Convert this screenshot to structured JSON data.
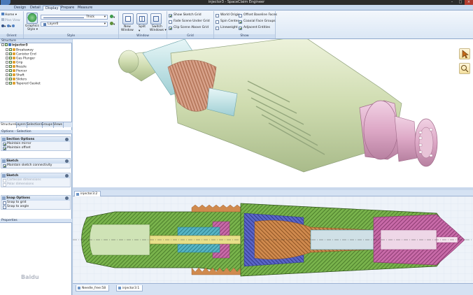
{
  "window": {
    "title": "injector3 - SpaceClaim Engineer",
    "min": "–",
    "max": "□",
    "close": "×"
  },
  "tabs": [
    "Design",
    "Detail",
    "Display",
    "Prepare",
    "Measure"
  ],
  "ribbon": {
    "orient": {
      "label": "Orient",
      "home": "Home",
      "plan_view": "Plan View"
    },
    "style": {
      "label": "Style",
      "graphics_style_top": "Graphics",
      "graphics_style_bottom": "Style",
      "line_weight": "Thick",
      "layer": "Layer0"
    },
    "window": {
      "label": "Window",
      "new_window_top": "New",
      "new_window_bottom": "Window",
      "split": "Split",
      "switch_top": "Switch",
      "switch_bottom": "Windows"
    },
    "grid": {
      "label": "Grid",
      "items": [
        {
          "label": "Show Sketch Grid",
          "checked": true
        },
        {
          "label": "Fade Scene Under Grid",
          "checked": false
        },
        {
          "label": "Clip Scene Above Grid",
          "checked": true
        }
      ]
    },
    "show": {
      "label": "Show",
      "col1": [
        {
          "label": "World Origin",
          "checked": false
        },
        {
          "label": "Spin Center",
          "checked": false
        },
        {
          "label": "Lineweight",
          "checked": false
        }
      ],
      "col2": [
        {
          "label": "Offset Baseline Faces",
          "checked": false
        },
        {
          "label": "Coaxial Face Groups",
          "checked": true
        },
        {
          "label": "Adjacent Entities",
          "checked": true
        }
      ]
    }
  },
  "structure": {
    "header": "Structure",
    "root": "injector3",
    "items": [
      "Breakaway",
      "Canister End",
      "Gas Plunger",
      "Grip",
      "Nozzle",
      "Piercer",
      "Shaft",
      "Sliders",
      "Tapered Gasket"
    ],
    "tabs": [
      "Structure",
      "Layers",
      "Selection",
      "Groups",
      "Views"
    ]
  },
  "options": {
    "header": "Options - Selection",
    "sections": [
      {
        "title": "Section Options",
        "rows": [
          {
            "label": "Maintain mirror",
            "checked": true,
            "disabled": false
          },
          {
            "label": "Maintain offset",
            "checked": true,
            "disabled": false
          }
        ]
      },
      {
        "title": "Sketch",
        "rows": [
          {
            "label": "Maintain sketch connectivity",
            "checked": true,
            "disabled": false
          }
        ]
      },
      {
        "title": "Sketch",
        "rows": [
          {
            "label": "Cartesian dimensions",
            "checked": false,
            "disabled": true
          },
          {
            "label": "Polar dimensions",
            "checked": false,
            "disabled": true
          }
        ]
      },
      {
        "title": "Snap Options",
        "rows": [
          {
            "label": "Snap to grid",
            "checked": false,
            "disabled": false
          },
          {
            "label": "Snap to angle",
            "checked": false,
            "disabled": false
          }
        ]
      }
    ]
  },
  "properties": {
    "header": "Properties"
  },
  "views": {
    "section_tab": "injector3:2",
    "bottom_tabs": [
      "Needle_free:58",
      "injector3:1"
    ]
  },
  "colors": {
    "grip": "#cfdcb0",
    "grip_edge": "#8fa17a",
    "nozzle": "#dda8c6",
    "cyan": "#bfe3e6",
    "copper": "#d8a28a"
  }
}
